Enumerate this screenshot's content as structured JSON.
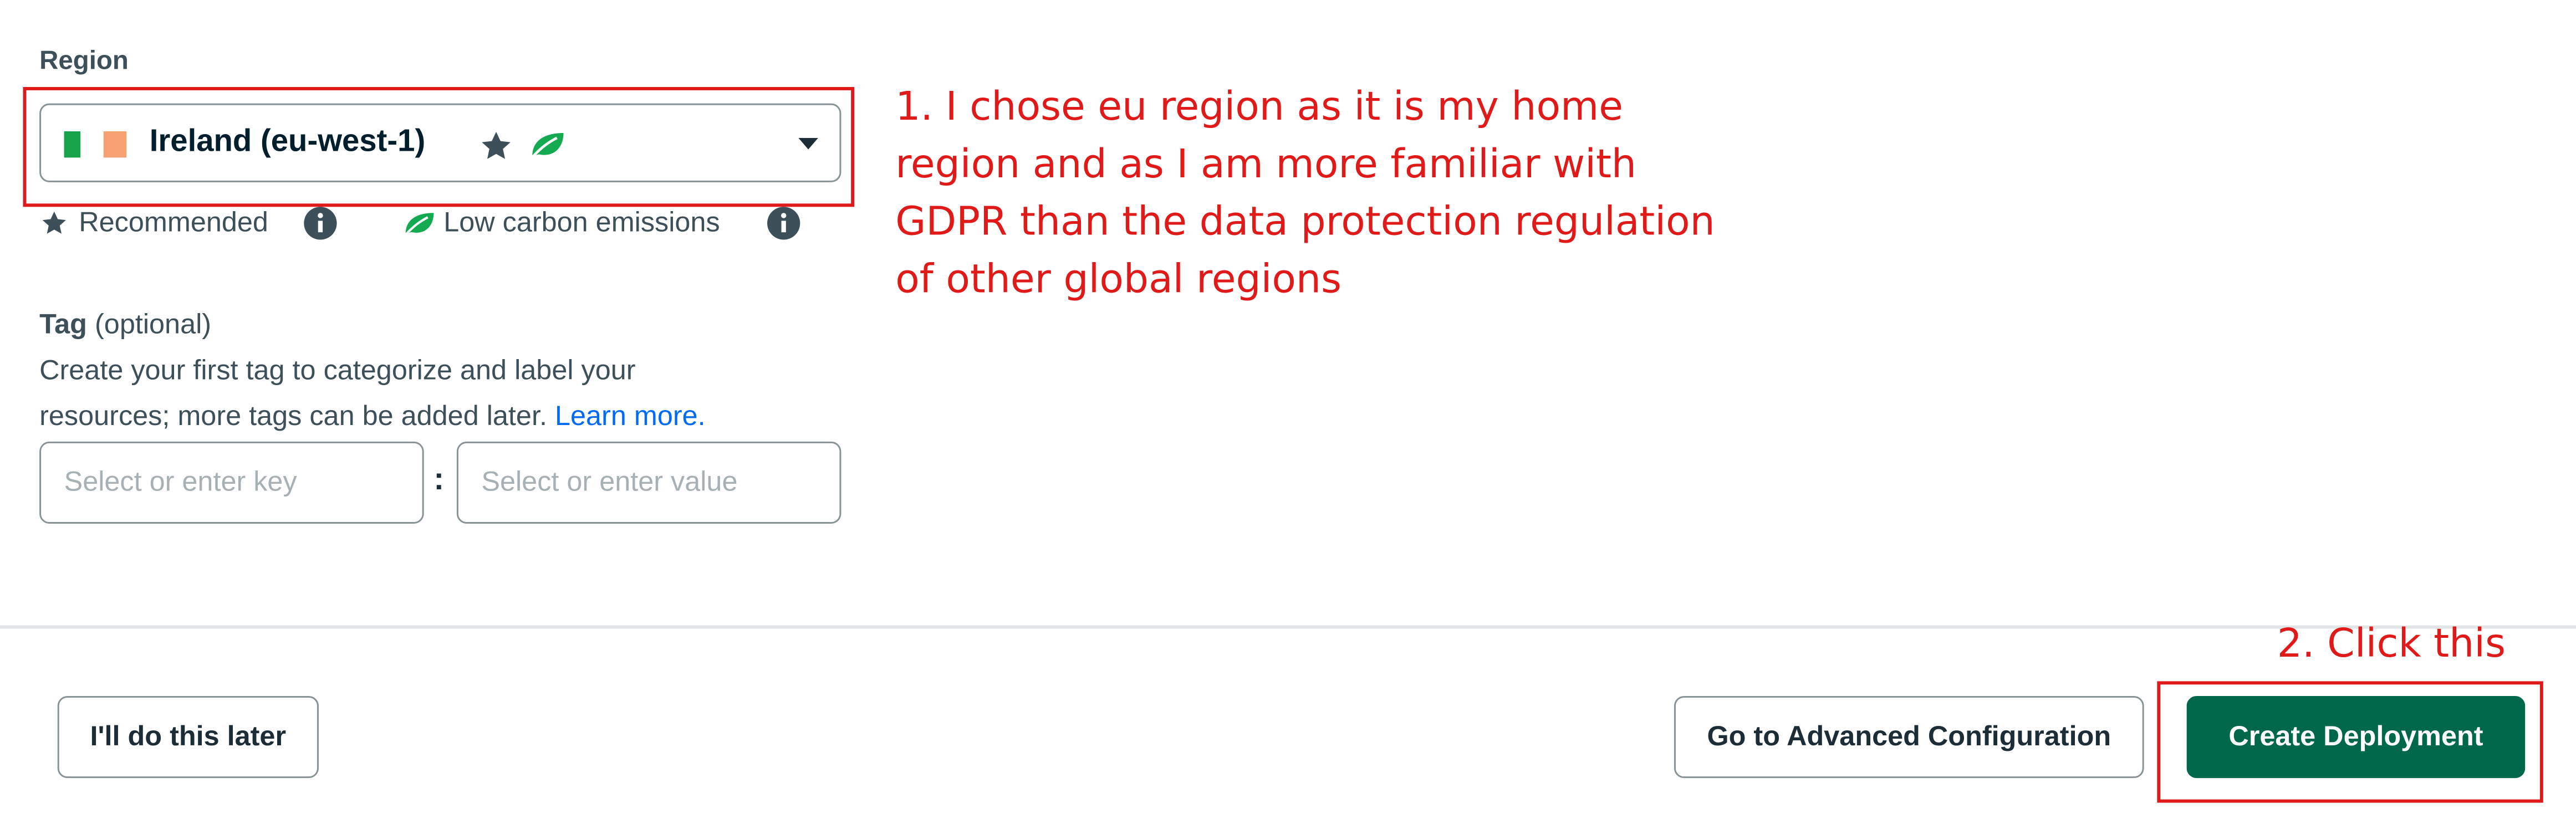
{
  "region": {
    "label": "Region",
    "selected_value": "Ireland (eu-west-1)",
    "flag_icon": "ireland-flag-icon",
    "badges": [
      "star-icon",
      "leaf-icon"
    ]
  },
  "legend": {
    "recommended": "Recommended",
    "low_carbon": "Low carbon emissions"
  },
  "tag": {
    "label": "Tag",
    "optional": "(optional)",
    "description_line1": "Create your first tag to categorize and label your",
    "description_line2": "resources; more tags can be added later.",
    "learn_more": "Learn more.",
    "key_placeholder": "Select or enter key",
    "separator": ":",
    "value_placeholder": "Select or enter value"
  },
  "footer": {
    "later_label": "I'll do this later",
    "advanced_label": "Go to Advanced Configuration",
    "create_label": "Create Deployment"
  },
  "annotations": {
    "note1_lines": [
      "1. I chose eu region as it is my home",
      "region and as I am more familiar with",
      "GDPR than the data protection regulation",
      "of other global regions"
    ],
    "note2": "2. Click this"
  },
  "colors": {
    "primary_button": "#00684a",
    "annotation": "#e01919",
    "link": "#016bf8",
    "leaf": "#13aa52"
  }
}
